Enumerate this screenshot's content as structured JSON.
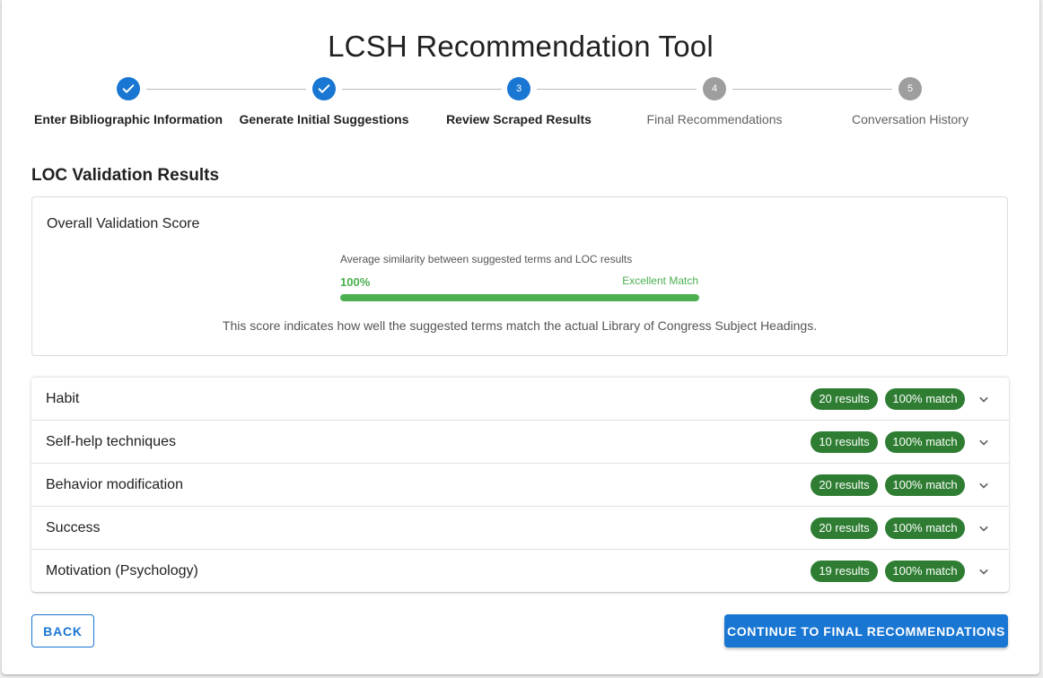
{
  "page": {
    "title": "LCSH Recommendation Tool"
  },
  "stepper": {
    "steps": [
      {
        "number": "1",
        "label": "Enter Bibliographic Information",
        "state": "completed"
      },
      {
        "number": "2",
        "label": "Generate Initial Suggestions",
        "state": "completed"
      },
      {
        "number": "3",
        "label": "Review Scraped Results",
        "state": "active"
      },
      {
        "number": "4",
        "label": "Final Recommendations",
        "state": "pending"
      },
      {
        "number": "5",
        "label": "Conversation History",
        "state": "pending"
      }
    ]
  },
  "validation": {
    "section_title": "LOC Validation Results",
    "card_title": "Overall Validation Score",
    "description": "Average similarity between suggested terms and LOC results",
    "score_label": "100%",
    "score_fraction": 1.0,
    "rating": "Excellent Match",
    "note": "This score indicates how well the suggested terms match the actual Library of Congress Subject Headings."
  },
  "terms": [
    {
      "label": "Habit",
      "results": "20 results",
      "match": "100% match"
    },
    {
      "label": "Self-help techniques",
      "results": "10 results",
      "match": "100% match"
    },
    {
      "label": "Behavior modification",
      "results": "20 results",
      "match": "100% match"
    },
    {
      "label": "Success",
      "results": "20 results",
      "match": "100% match"
    },
    {
      "label": "Motivation (Psychology)",
      "results": "19 results",
      "match": "100% match"
    }
  ],
  "actions": {
    "back_label": "BACK",
    "continue_label": "CONTINUE TO FINAL RECOMMENDATIONS"
  },
  "colors": {
    "primary": "#1976d2",
    "success": "#4caf50",
    "chip": "#2e7d32",
    "pending": "#9e9e9e"
  },
  "icons": {
    "completed_step": "check-icon",
    "expand": "chevron-down-icon"
  }
}
